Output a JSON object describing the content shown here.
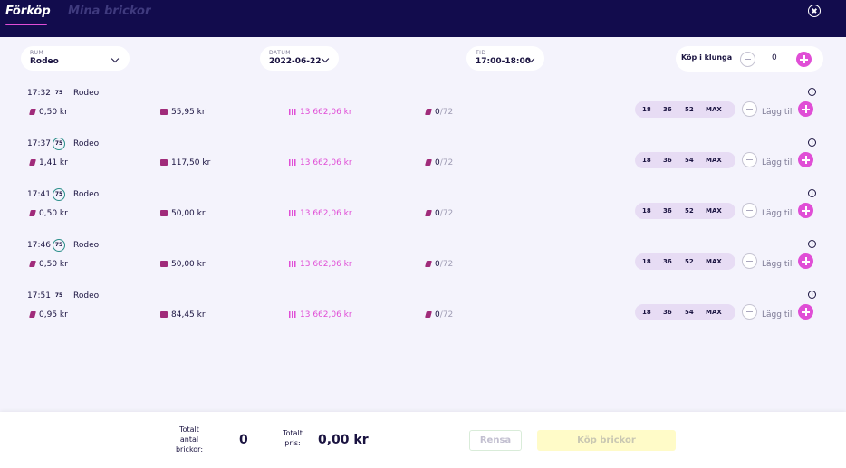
{
  "header": {
    "tabs": [
      {
        "label": "Förköp",
        "active": true
      },
      {
        "label": "Mina brickor",
        "active": false
      }
    ]
  },
  "filters": {
    "room": {
      "label": "RUM",
      "value": "Rodeo"
    },
    "date": {
      "label": "DATUM",
      "value": "2022-06-22"
    },
    "time": {
      "label": "TID",
      "value": "17:00-18:00"
    }
  },
  "group_buy": {
    "label": "Köp i klunga",
    "count": "0"
  },
  "games": [
    {
      "time": "17:32",
      "badge": "75",
      "room": "Rodeo",
      "price": "0,50 kr",
      "win": "55,95 kr",
      "jackpot": "13 662,06 kr",
      "count": "0",
      "max": "/72",
      "options": [
        "18",
        "36",
        "52",
        "MAX"
      ],
      "add_label": "Lägg till"
    },
    {
      "time": "17:37",
      "badge": "75",
      "room": "Rodeo",
      "price": "1,41 kr",
      "win": "117,50 kr",
      "jackpot": "13 662,06 kr",
      "count": "0",
      "max": "/72",
      "options": [
        "18",
        "36",
        "54",
        "MAX"
      ],
      "add_label": "Lägg till"
    },
    {
      "time": "17:41",
      "badge": "75",
      "room": "Rodeo",
      "price": "0,50 kr",
      "win": "50,00 kr",
      "jackpot": "13 662,06 kr",
      "count": "0",
      "max": "/72",
      "options": [
        "18",
        "36",
        "52",
        "MAX"
      ],
      "add_label": "Lägg till"
    },
    {
      "time": "17:46",
      "badge": "75",
      "room": "Rodeo",
      "price": "0,50 kr",
      "win": "50,00 kr",
      "jackpot": "13 662,06 kr",
      "count": "0",
      "max": "/72",
      "options": [
        "18",
        "36",
        "52",
        "MAX"
      ],
      "add_label": "Lägg till"
    },
    {
      "time": "17:51",
      "badge": "75",
      "room": "Rodeo",
      "price": "0,95 kr",
      "win": "84,45 kr",
      "jackpot": "13 662,06 kr",
      "count": "0",
      "max": "/72",
      "options": [
        "18",
        "36",
        "54",
        "MAX"
      ],
      "add_label": "Lägg till"
    }
  ],
  "footer": {
    "total_label": "Totalt antal brickor:",
    "total_value": "0",
    "price_label": "Totalt pris:",
    "price_value": "0,00 kr",
    "clear_label": "Rensa",
    "buy_label": "Köp brickor"
  },
  "colors": {
    "header_bg": "#120c4d",
    "accent": "#e04ed6",
    "page_bg": "#f4f3fc",
    "buy_button_bg": "#fffbc8"
  },
  "icons": {
    "price": "ticket-icon",
    "win": "gift-icon",
    "jackpot": "jackpot-icon",
    "count": "ticket-icon",
    "info": "info-icon",
    "close": "close-icon"
  }
}
